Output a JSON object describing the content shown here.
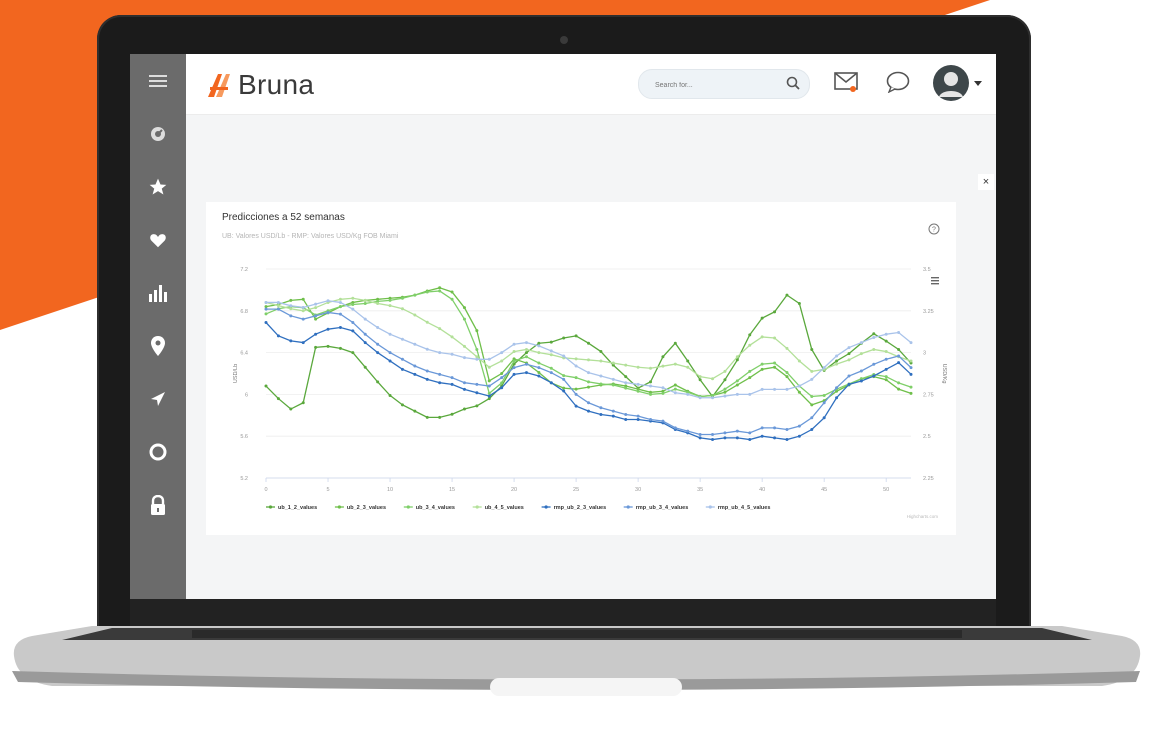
{
  "colors": {
    "orange": "#f2661f",
    "sidebar": "#6b6b6b",
    "series": [
      "#5aa83c",
      "#6fbf4a",
      "#7fcf69",
      "#b3e099",
      "#2f6fbf",
      "#6a98d8",
      "#a9c3ea"
    ]
  },
  "header": {
    "logo_mark": "A",
    "logo_text": "Bruna",
    "search_placeholder": "Search for..."
  },
  "sidebar": {
    "items": [
      {
        "icon": "menu-icon"
      },
      {
        "icon": "dashboard-icon"
      },
      {
        "icon": "star-icon"
      },
      {
        "icon": "heart-icon"
      },
      {
        "icon": "bar-chart-icon"
      },
      {
        "icon": "map-pin-icon"
      },
      {
        "icon": "navigation-icon"
      },
      {
        "icon": "circle-icon"
      },
      {
        "icon": "lock-icon"
      }
    ]
  },
  "close_label": "×",
  "card": {
    "title": "Predicciones a 52 semanas",
    "subtitle": "UB: Valores USD/Lb - RMP: Valores USD/Kg FOB Miami",
    "credit": "Highcharts.com"
  },
  "chart_data": {
    "type": "line",
    "title": "Predicciones a 52 semanas",
    "subtitle": "UB: Valores USD/Lb - RMP: Valores USD/Kg FOB Miami",
    "xlabel": "",
    "ylabel": "USD/Lb",
    "y2label": "USD/Kg",
    "xlim": [
      0,
      52
    ],
    "ylim": [
      5.2,
      7.2
    ],
    "y2lim": [
      2.25,
      3.5
    ],
    "x_ticks": [
      "0",
      "5",
      "10",
      "15",
      "20",
      "25",
      "30",
      "35",
      "40",
      "45",
      "50"
    ],
    "y_ticks": [
      "5.2",
      "5.6",
      "6",
      "6.4",
      "6.8",
      "7.2"
    ],
    "y2_ticks": [
      "2.25",
      "2.5",
      "2.75",
      "3",
      "3.25",
      "3.5"
    ],
    "grid": true,
    "legend_position": "bottom",
    "series": [
      {
        "name": "ub_1_2_values",
        "axis": "left",
        "values": [
          6.08,
          5.96,
          5.86,
          5.92,
          6.45,
          6.46,
          6.44,
          6.4,
          6.26,
          6.12,
          5.99,
          5.9,
          5.84,
          5.78,
          5.78,
          5.81,
          5.86,
          5.89,
          5.96,
          6.08,
          6.29,
          6.4,
          6.49,
          6.5,
          6.54,
          6.56,
          6.49,
          6.41,
          6.28,
          6.17,
          6.06,
          6.12,
          6.36,
          6.49,
          6.32,
          6.14,
          5.98,
          6.14,
          6.33,
          6.57,
          6.73,
          6.79,
          6.95,
          6.87,
          6.43,
          6.23,
          6.32,
          6.39,
          6.49,
          6.58,
          6.51,
          6.43,
          6.3
        ]
      },
      {
        "name": "ub_2_3_values",
        "axis": "left",
        "values": [
          6.84,
          6.86,
          6.9,
          6.91,
          6.72,
          6.78,
          6.84,
          6.88,
          6.9,
          6.91,
          6.92,
          6.93,
          6.95,
          6.99,
          7.02,
          6.98,
          6.83,
          6.61,
          6.13,
          6.2,
          6.34,
          6.3,
          6.21,
          6.11,
          6.06,
          6.05,
          6.07,
          6.09,
          6.1,
          6.08,
          6.05,
          6.02,
          6.03,
          6.09,
          6.03,
          5.98,
          5.99,
          6.02,
          6.09,
          6.16,
          6.24,
          6.26,
          6.17,
          6.02,
          5.9,
          5.94,
          6.03,
          6.09,
          6.15,
          6.17,
          6.14,
          6.05,
          6.01
        ]
      },
      {
        "name": "ub_3_4_values",
        "axis": "left",
        "values": [
          6.77,
          6.82,
          6.84,
          6.83,
          6.76,
          6.8,
          6.84,
          6.86,
          6.87,
          6.89,
          6.9,
          6.92,
          6.95,
          6.98,
          6.99,
          6.91,
          6.72,
          6.43,
          6.01,
          6.11,
          6.32,
          6.36,
          6.3,
          6.25,
          6.18,
          6.16,
          6.12,
          6.1,
          6.09,
          6.06,
          6.03,
          6.0,
          6.01,
          6.05,
          6.02,
          5.98,
          5.99,
          6.05,
          6.13,
          6.22,
          6.29,
          6.3,
          6.21,
          6.08,
          5.98,
          5.99,
          6.05,
          6.1,
          6.15,
          6.19,
          6.17,
          6.11,
          6.07
        ]
      },
      {
        "name": "ub_4_5_values",
        "axis": "left",
        "values": [
          6.88,
          6.85,
          6.82,
          6.8,
          6.83,
          6.88,
          6.91,
          6.92,
          6.9,
          6.87,
          6.85,
          6.82,
          6.76,
          6.69,
          6.63,
          6.55,
          6.46,
          6.36,
          6.26,
          6.32,
          6.41,
          6.43,
          6.4,
          6.38,
          6.35,
          6.34,
          6.33,
          6.32,
          6.3,
          6.28,
          6.26,
          6.25,
          6.27,
          6.29,
          6.26,
          6.17,
          6.15,
          6.22,
          6.36,
          6.47,
          6.55,
          6.54,
          6.44,
          6.32,
          6.22,
          6.24,
          6.29,
          6.33,
          6.39,
          6.43,
          6.41,
          6.36,
          6.32
        ]
      },
      {
        "name": "rmp_ub_2_3_values",
        "axis": "right",
        "values": [
          3.18,
          3.1,
          3.07,
          3.06,
          3.11,
          3.14,
          3.15,
          3.13,
          3.06,
          3.0,
          2.95,
          2.9,
          2.87,
          2.84,
          2.82,
          2.81,
          2.78,
          2.76,
          2.74,
          2.79,
          2.87,
          2.88,
          2.86,
          2.82,
          2.77,
          2.68,
          2.65,
          2.63,
          2.62,
          2.6,
          2.6,
          2.59,
          2.58,
          2.54,
          2.52,
          2.49,
          2.48,
          2.49,
          2.49,
          2.48,
          2.5,
          2.49,
          2.48,
          2.5,
          2.54,
          2.61,
          2.73,
          2.81,
          2.83,
          2.86,
          2.9,
          2.94,
          2.87
        ]
      },
      {
        "name": "rmp_ub_3_4_values",
        "axis": "right",
        "values": [
          3.26,
          3.26,
          3.22,
          3.2,
          3.22,
          3.24,
          3.23,
          3.18,
          3.11,
          3.05,
          3.0,
          2.96,
          2.92,
          2.89,
          2.87,
          2.85,
          2.82,
          2.81,
          2.8,
          2.85,
          2.91,
          2.93,
          2.91,
          2.88,
          2.84,
          2.75,
          2.7,
          2.67,
          2.65,
          2.63,
          2.62,
          2.6,
          2.59,
          2.55,
          2.53,
          2.51,
          2.51,
          2.52,
          2.53,
          2.52,
          2.55,
          2.55,
          2.54,
          2.56,
          2.61,
          2.7,
          2.79,
          2.86,
          2.89,
          2.93,
          2.96,
          2.98,
          2.91
        ]
      },
      {
        "name": "rmp_ub_4_5_values",
        "axis": "right",
        "values": [
          3.3,
          3.3,
          3.28,
          3.27,
          3.29,
          3.31,
          3.3,
          3.26,
          3.2,
          3.15,
          3.11,
          3.08,
          3.05,
          3.02,
          3.0,
          2.99,
          2.97,
          2.96,
          2.96,
          3.0,
          3.05,
          3.06,
          3.04,
          3.01,
          2.98,
          2.92,
          2.88,
          2.86,
          2.84,
          2.82,
          2.81,
          2.8,
          2.79,
          2.76,
          2.75,
          2.73,
          2.73,
          2.74,
          2.75,
          2.75,
          2.78,
          2.78,
          2.78,
          2.8,
          2.84,
          2.91,
          2.98,
          3.03,
          3.06,
          3.09,
          3.11,
          3.12,
          3.06
        ]
      }
    ]
  }
}
